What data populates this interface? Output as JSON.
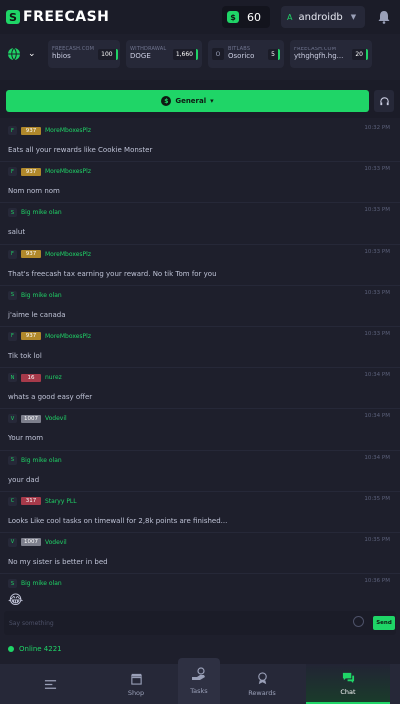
{
  "header": {
    "logo_free": "FREE",
    "logo_cash": "CASH",
    "balance": "60",
    "username": "androidb",
    "user_initial": "A"
  },
  "ticker": {
    "items": [
      {
        "source": "FREECASH.COM",
        "name": "hbios",
        "amount": "100"
      },
      {
        "source": "WITHDRAWAL",
        "name": "DOGE",
        "amount": "1,660"
      },
      {
        "source": "BITLABS",
        "name": "Osorico",
        "avatar": "O",
        "amount": "5"
      },
      {
        "source": "FREECASH.COM",
        "name": "ythghgfh.hg...",
        "amount": "20"
      }
    ]
  },
  "chat": {
    "room": "General",
    "messages": [
      {
        "av": "F",
        "level": "937",
        "level_color": "#b0882b",
        "user": "MoreMboxesPlz",
        "time": "10:32 PM",
        "text": "Eats all your rewards like Cookie Monster"
      },
      {
        "av": "F",
        "level": "937",
        "level_color": "#b0882b",
        "user": "MoreMboxesPlz",
        "time": "10:33 PM",
        "text": "Nom nom nom"
      },
      {
        "av": "S",
        "level": "",
        "level_color": "",
        "user": "Big mike olan",
        "time": "10:33 PM",
        "text": "salut"
      },
      {
        "av": "F",
        "level": "937",
        "level_color": "#b0882b",
        "user": "MoreMboxesPlz",
        "time": "10:33 PM",
        "text": "That's freecash tax earning your reward. No tik Tom for you"
      },
      {
        "av": "S",
        "level": "",
        "level_color": "",
        "user": "Big mike olan",
        "time": "10:33 PM",
        "text": "j'aime le canada"
      },
      {
        "av": "F",
        "level": "937",
        "level_color": "#b0882b",
        "user": "MoreMboxesPlz",
        "time": "10:33 PM",
        "text": "Tik tok lol"
      },
      {
        "av": "N",
        "level": "16",
        "level_color": "#a63a4a",
        "user": "nurez",
        "time": "10:34 PM",
        "text": "whats a good easy offer"
      },
      {
        "av": "V",
        "level": "1007",
        "level_color": "#7d7f8c",
        "user": "Vodevil",
        "time": "10:34 PM",
        "text": "Your mom"
      },
      {
        "av": "S",
        "level": "",
        "level_color": "",
        "user": "Big mike olan",
        "time": "10:34 PM",
        "text": "your dad"
      },
      {
        "av": "C",
        "level": "317",
        "level_color": "#a63a4a",
        "user": "Staryy PLL",
        "time": "10:35 PM",
        "text": "Looks Like cool tasks on timewall for 2,8k points are finished..."
      },
      {
        "av": "V",
        "level": "1007",
        "level_color": "#7d7f8c",
        "user": "Vodevil",
        "time": "10:35 PM",
        "text": "No my sister is better in bed"
      },
      {
        "av": "S",
        "level": "",
        "level_color": "",
        "user": "Big mike olan",
        "time": "10:36 PM",
        "text": "😂"
      }
    ],
    "input_placeholder": "Say something",
    "send_label": "Send",
    "online": "Online 4221"
  },
  "nav": {
    "shop": "Shop",
    "tasks": "Tasks",
    "rewards": "Rewards",
    "chat": "Chat"
  },
  "colors": {
    "accent": "#1fd567",
    "bg": "#1e1f2c",
    "panel": "#262838"
  }
}
